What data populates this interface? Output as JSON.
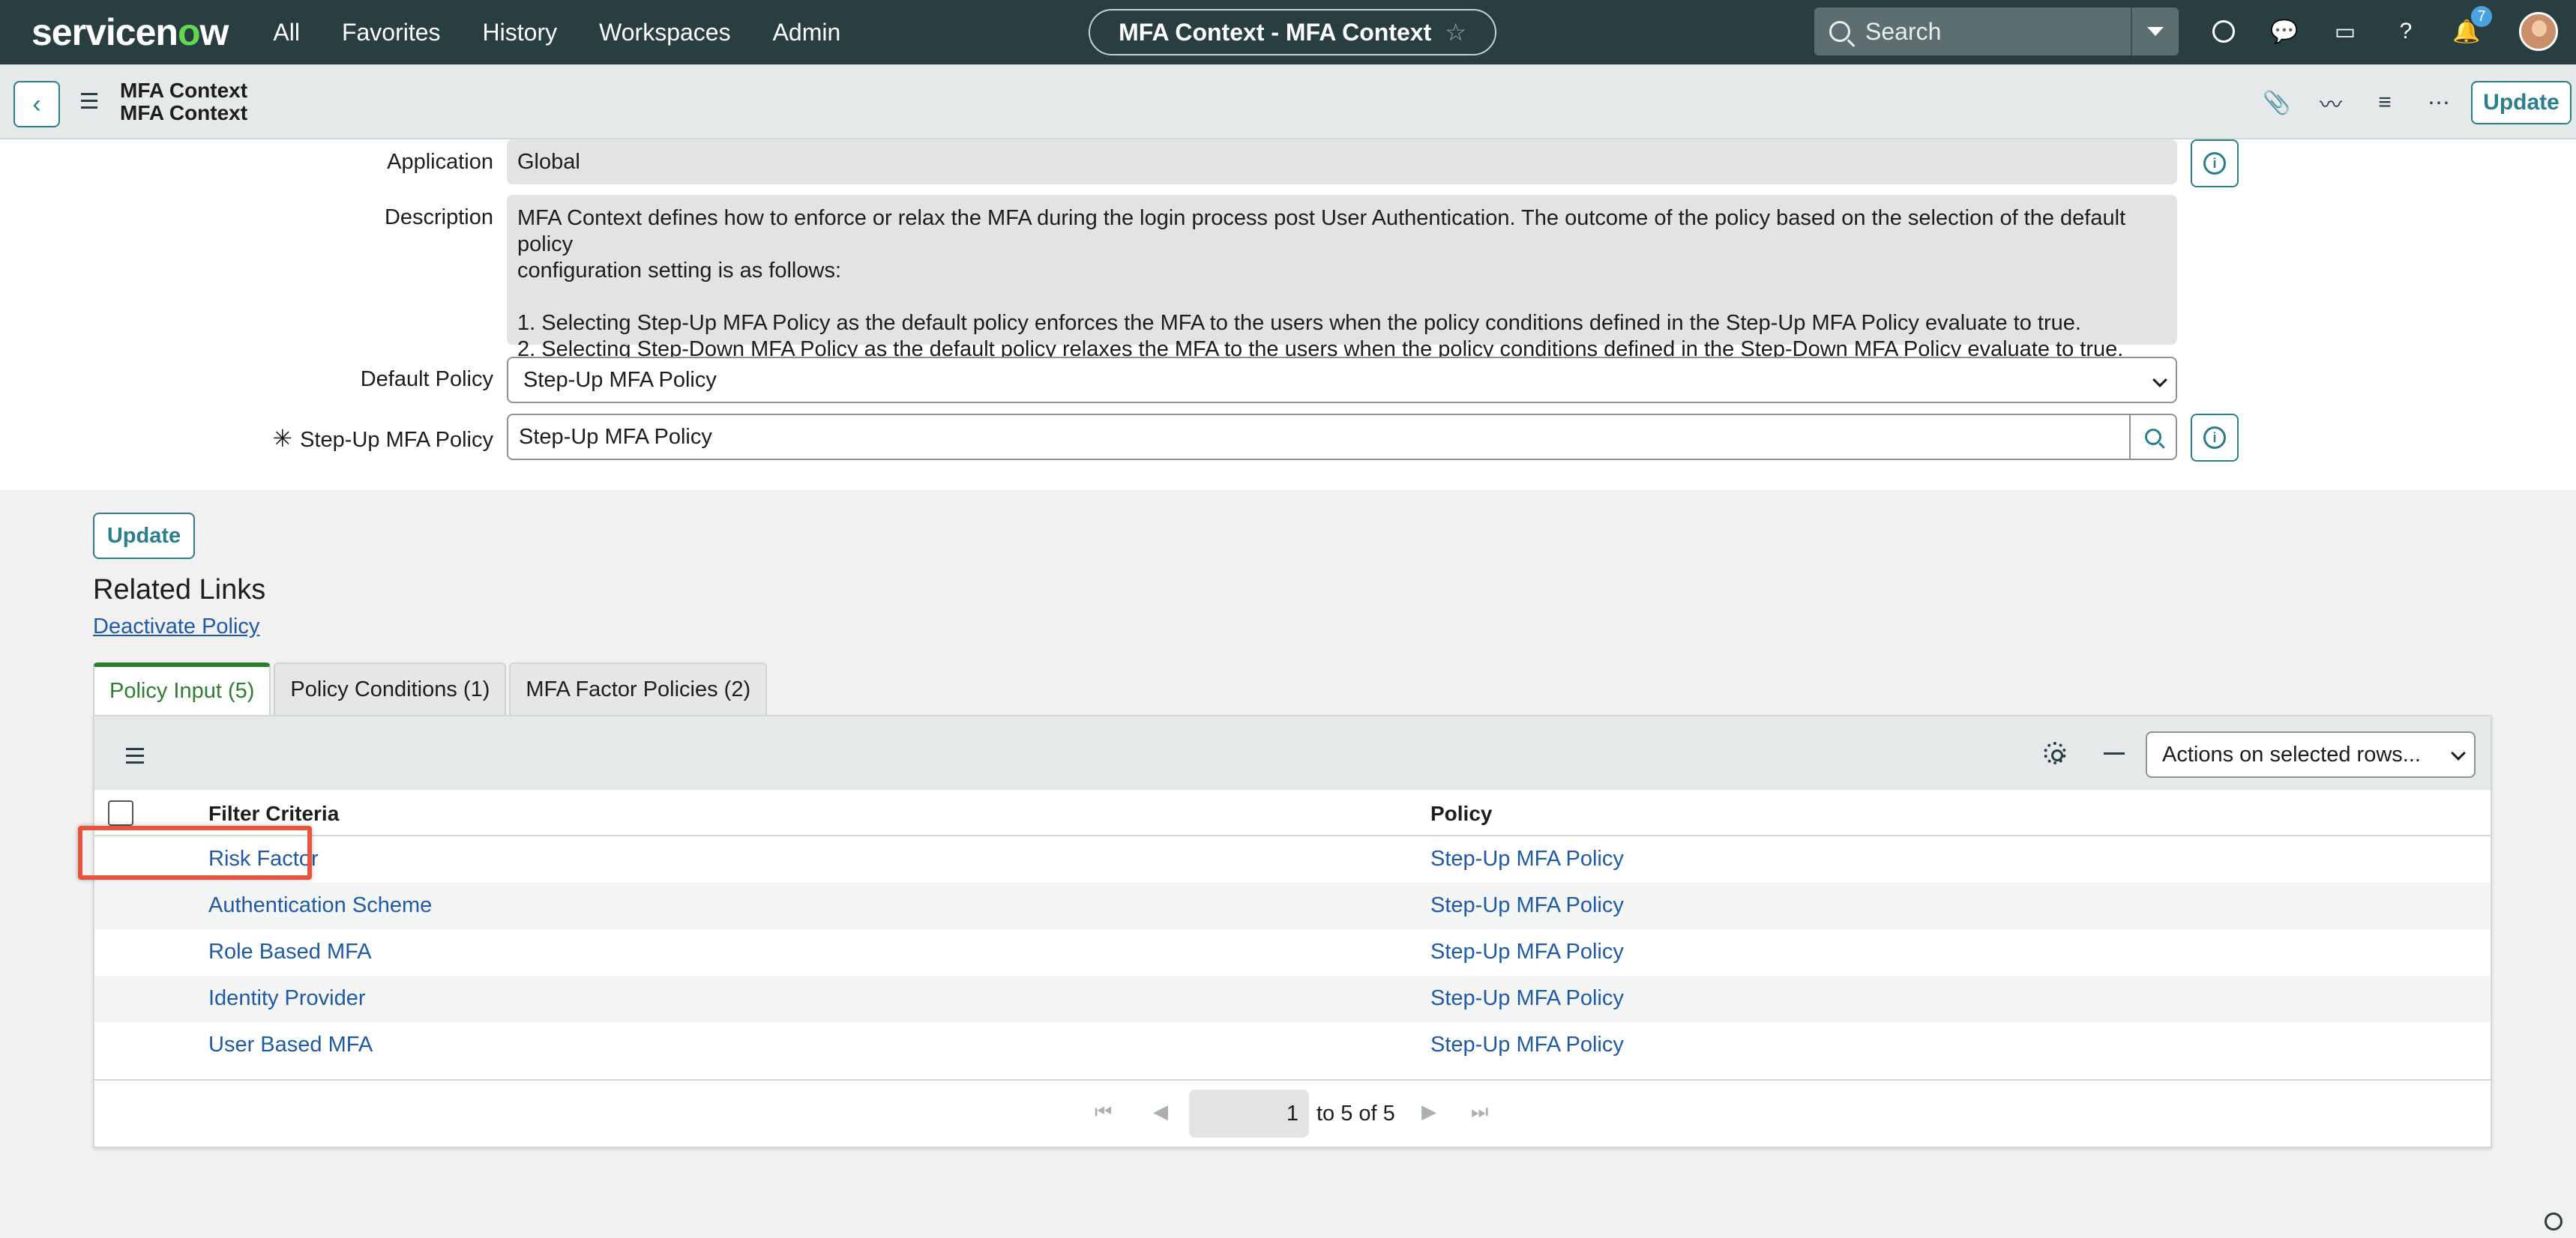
{
  "topnav": {
    "logo_text_a": "servicen",
    "logo_text_o": "o",
    "logo_text_b": "w",
    "links": [
      "All",
      "Favorites",
      "History",
      "Workspaces",
      "Admin"
    ],
    "context_title": "MFA Context - MFA Context",
    "search_placeholder": "Search",
    "notification_count": "7"
  },
  "header": {
    "title_line1": "MFA Context",
    "title_line2": "MFA Context",
    "update_label": "Update"
  },
  "form": {
    "application_label": "Application",
    "application_value": "Global",
    "description_label": "Description",
    "description_line1": "MFA Context defines how to enforce or relax the MFA during the login process post User Authentication. The outcome of the policy based on the selection of the default policy",
    "description_line2": "configuration setting is as follows:",
    "description_line3": "1. Selecting Step-Up MFA Policy as the default policy enforces the MFA to the users when the policy conditions defined in the Step-Up MFA Policy evaluate to true.",
    "description_line4": "2. Selecting Step-Down MFA Policy as the default policy relaxes the MFA to the users when the policy conditions defined in the Step-Down MFA Policy evaluate to true.",
    "default_policy_label": "Default Policy",
    "default_policy_value": "Step-Up MFA Policy",
    "stepup_label": "Step-Up MFA Policy",
    "stepup_value": "Step-Up MFA Policy"
  },
  "lower": {
    "update_label": "Update",
    "related_links_heading": "Related Links",
    "deactivate_link": "Deactivate Policy"
  },
  "tabs": [
    {
      "label": "Policy Input (5)",
      "active": true
    },
    {
      "label": "Policy Conditions (1)",
      "active": false
    },
    {
      "label": "MFA Factor Policies (2)",
      "active": false
    }
  ],
  "list": {
    "actions_select": "Actions on selected rows...",
    "columns": [
      "Filter Criteria",
      "Policy"
    ],
    "rows": [
      {
        "filter": "Risk Factor",
        "policy": "Step-Up MFA Policy"
      },
      {
        "filter": "Authentication Scheme",
        "policy": "Step-Up MFA Policy"
      },
      {
        "filter": "Role Based MFA",
        "policy": "Step-Up MFA Policy"
      },
      {
        "filter": "Identity Provider",
        "policy": "Step-Up MFA Policy"
      },
      {
        "filter": "User Based MFA",
        "policy": "Step-Up MFA Policy"
      }
    ],
    "pager_current": "1",
    "pager_text": "to 5 of 5"
  },
  "colors": {
    "nav_bg": "#293e40",
    "accent": "#2b7f8a",
    "link": "#1f5aa6",
    "active_tab": "#2e7d32",
    "highlight": "#e8553e"
  }
}
